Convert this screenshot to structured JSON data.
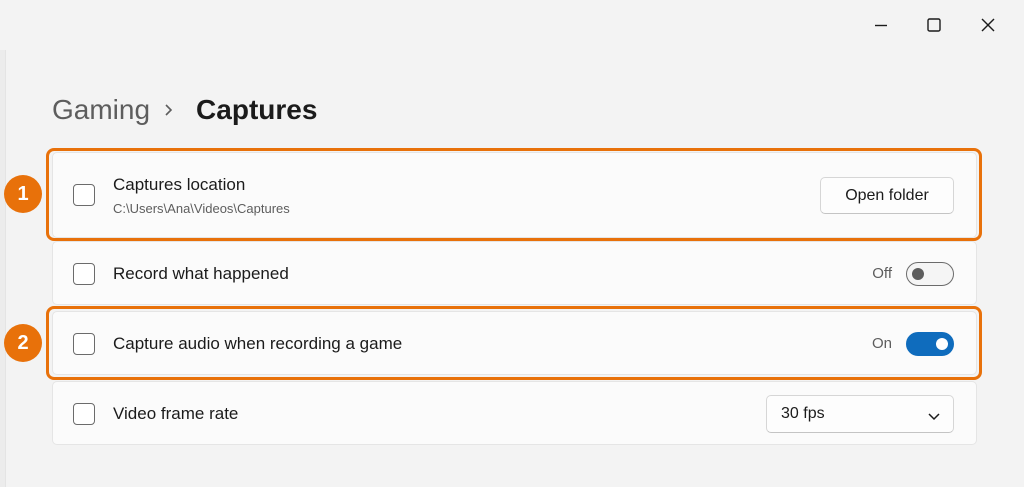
{
  "window": {
    "controls": {
      "minimize_icon": "minimize-icon",
      "maximize_icon": "maximize-icon",
      "close_icon": "close-icon"
    }
  },
  "breadcrumb": {
    "parent": "Gaming",
    "separator_icon": "chevron-right-icon",
    "current": "Captures"
  },
  "settings": {
    "captures_location": {
      "title": "Captures location",
      "path": "C:\\Users\\Ana\\Videos\\Captures",
      "button_label": "Open folder",
      "checked": false
    },
    "record_what_happened": {
      "title": "Record what happened",
      "state_label": "Off",
      "enabled": false,
      "checked": false
    },
    "capture_audio": {
      "title": "Capture audio when recording a game",
      "state_label": "On",
      "enabled": true,
      "checked": false
    },
    "video_frame_rate": {
      "title": "Video frame rate",
      "selected": "30 fps",
      "checked": false
    }
  },
  "callouts": [
    {
      "label": "1",
      "color": "#e8710a"
    },
    {
      "label": "2",
      "color": "#e8710a"
    }
  ],
  "colors": {
    "accent": "#0f6cbd",
    "callout": "#e8710a",
    "background": "#f3f3f3",
    "card": "#fbfbfb"
  }
}
